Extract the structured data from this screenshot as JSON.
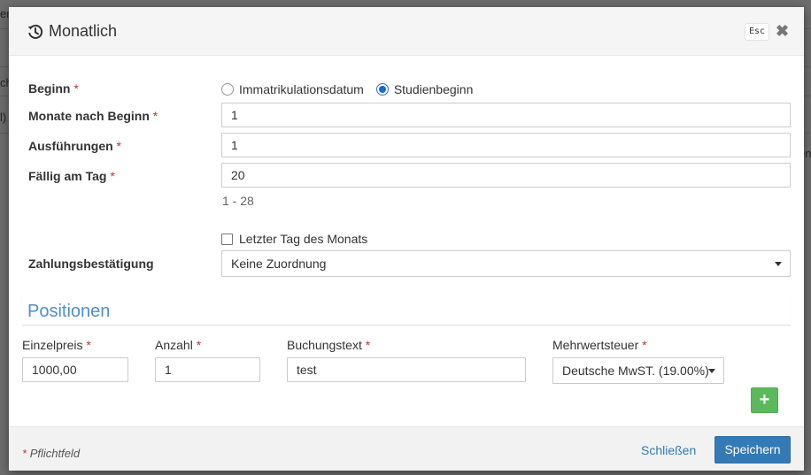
{
  "background": {
    "fragments": [
      "er",
      "ch",
      "l)",
      "en"
    ]
  },
  "modal": {
    "title": "Monatlich",
    "esc_label": "Esc",
    "close_glyph": "✖"
  },
  "form": {
    "beginn": {
      "label": "Beginn",
      "required_mark": "*",
      "options": [
        "Immatrikulationsdatum",
        "Studienbeginn"
      ],
      "selected": "Studienbeginn"
    },
    "monate_nach_beginn": {
      "label": "Monate nach Beginn",
      "required_mark": "*",
      "value": "1"
    },
    "ausfuehrungen": {
      "label": "Ausführungen",
      "required_mark": "*",
      "value": "1"
    },
    "faellig_am_tag": {
      "label": "Fällig am Tag",
      "required_mark": "*",
      "value": "20",
      "help": "1 - 28"
    },
    "letzter_tag": {
      "label": "Letzter Tag des Monats",
      "checked": false
    },
    "zahlungsbestaetigung": {
      "label": "Zahlungsbestätigung",
      "selected": "Keine Zuordnung"
    }
  },
  "positionen": {
    "title": "Positionen",
    "columns": [
      {
        "label": "Einzelpreis",
        "required_mark": "*",
        "value": "1000,00"
      },
      {
        "label": "Anzahl",
        "required_mark": "*",
        "value": "1"
      },
      {
        "label": "Buchungstext",
        "required_mark": "*",
        "value": "test"
      },
      {
        "label": "Mehrwertsteuer",
        "required_mark": "*",
        "value": "Deutsche MwST. (19.00%)"
      }
    ],
    "add_label": "+"
  },
  "footer": {
    "required_mark": "*",
    "note": "Pflichtfeld",
    "close_label": "Schließen",
    "save_label": "Speichern"
  },
  "colors": {
    "primary": "#337ab7",
    "success": "#5cb85c",
    "required": "#c9302c",
    "section_title": "#4f8fc9"
  }
}
